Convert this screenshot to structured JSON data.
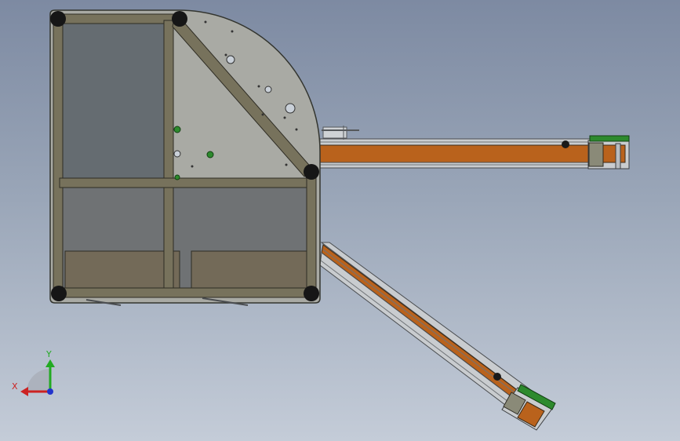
{
  "viewport": {
    "background_top": "#7d8aa2",
    "background_bottom": "#c4ccd8"
  },
  "colors": {
    "frame": "#77725c",
    "frame_edge": "#2e2c24",
    "plate": "#a9aaa4",
    "panel_glass": "#656c71",
    "panel_lower": "#6f7274",
    "box": "#736a58",
    "conveyor_belt": "#b9621c",
    "conveyor_rail": "#c9cccf",
    "conveyor_motor": "#8a8a78",
    "green_part": "#2d8a2d",
    "foot": "#161616"
  },
  "triad": {
    "x_label": "X",
    "y_label": "Y",
    "x_axis_color": "#cc2222",
    "y_axis_color": "#22aa22",
    "z_axis_color": "#2233cc"
  }
}
